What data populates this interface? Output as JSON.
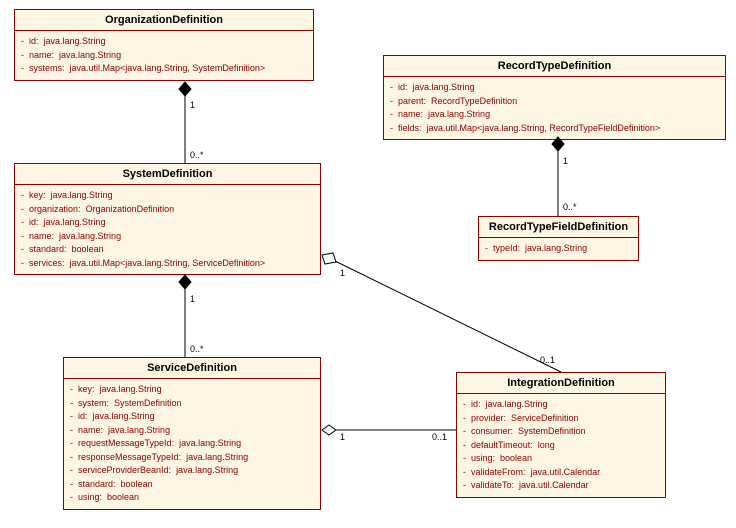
{
  "classes": {
    "organization": {
      "name": "OrganizationDefinition",
      "attrs": [
        {
          "n": "id",
          "t": "java.lang.String"
        },
        {
          "n": "name",
          "t": "java.lang.String"
        },
        {
          "n": "systems",
          "t": "java.util.Map<java.lang.String, SystemDefinition>"
        }
      ]
    },
    "system": {
      "name": "SystemDefinition",
      "attrs": [
        {
          "n": "key",
          "t": "java.lang.String"
        },
        {
          "n": "organization",
          "t": "OrganizationDefinition"
        },
        {
          "n": "id",
          "t": "java.lang.String"
        },
        {
          "n": "name",
          "t": "java.lang.String"
        },
        {
          "n": "standard",
          "t": "boolean"
        },
        {
          "n": "services",
          "t": "java.util.Map<java.lang.String, ServiceDefinition>"
        }
      ]
    },
    "service": {
      "name": "ServiceDefinition",
      "attrs": [
        {
          "n": "key",
          "t": "java.lang.String"
        },
        {
          "n": "system",
          "t": "SystemDefinition"
        },
        {
          "n": "id",
          "t": "java.lang.String"
        },
        {
          "n": "name",
          "t": "java.lang.String"
        },
        {
          "n": "requestMessageTypeId",
          "t": "java.lang.String"
        },
        {
          "n": "responseMessageTypeId",
          "t": "java.lang.String"
        },
        {
          "n": "serviceProviderBeanId",
          "t": "java.lang.String"
        },
        {
          "n": "standard",
          "t": "boolean"
        },
        {
          "n": "using",
          "t": "boolean"
        }
      ]
    },
    "integration": {
      "name": "IntegrationDefinition",
      "attrs": [
        {
          "n": "id",
          "t": "java.lang.String"
        },
        {
          "n": "provider",
          "t": "ServiceDefinition"
        },
        {
          "n": "consumer",
          "t": "SystemDefinition"
        },
        {
          "n": "defaultTimeout",
          "t": "long"
        },
        {
          "n": "using",
          "t": "boolean"
        },
        {
          "n": "validateFrom",
          "t": "java.util.Calendar"
        },
        {
          "n": "validateTo",
          "t": "java.util.Calendar"
        }
      ]
    },
    "recordtype": {
      "name": "RecordTypeDefinition",
      "attrs": [
        {
          "n": "id",
          "t": "java.lang.String"
        },
        {
          "n": "parent",
          "t": "RecordTypeDefinition"
        },
        {
          "n": "name",
          "t": "java.lang.String"
        },
        {
          "n": "fields",
          "t": "java.util.Map<java.lang.String, RecordTypeFieldDefinition>"
        }
      ]
    },
    "recordfield": {
      "name": "RecordTypeFieldDefinition",
      "attrs": [
        {
          "n": "typeId",
          "t": "java.lang.String"
        }
      ]
    }
  },
  "mult": {
    "one": "1",
    "zeromany": "0..*",
    "zeroone": "0..1"
  }
}
